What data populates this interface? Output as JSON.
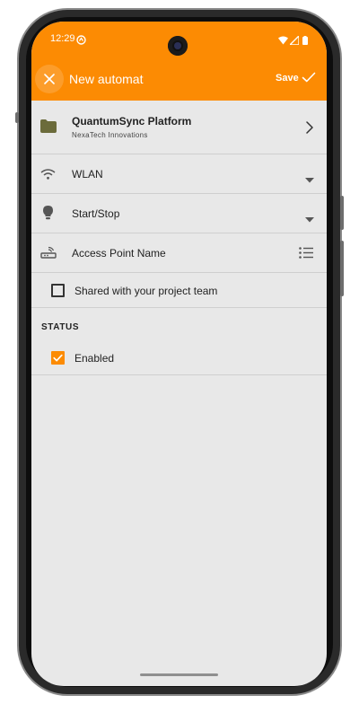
{
  "status_bar": {
    "time": "12:29"
  },
  "app_bar": {
    "title": "New automat",
    "save_label": "Save"
  },
  "form": {
    "platform": {
      "title": "QuantumSync Platform",
      "subtitle": "NexaTech Innovations"
    },
    "wlan_label": "WLAN",
    "start_stop_label": "Start/Stop",
    "apn_label": "Access Point Name",
    "shared_label": "Shared with your project team",
    "shared_checked": false
  },
  "status_section": {
    "header": "STATUS",
    "enabled_label": "Enabled",
    "enabled_checked": true
  },
  "colors": {
    "accent": "#fc8b03",
    "background": "#e8e8e8"
  }
}
